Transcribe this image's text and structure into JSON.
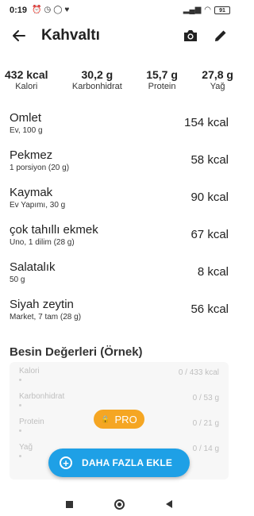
{
  "status_bar": {
    "time": "0:19",
    "battery": "91",
    "icons": [
      "alarm-icon",
      "clock-icon",
      "whatsapp-icon",
      "app-notification-icon",
      "signal-icon",
      "wifi-icon",
      "battery-icon"
    ]
  },
  "app_bar": {
    "title": "Kahvaltı",
    "back_icon": "arrow-left-icon",
    "actions": [
      "camera-icon",
      "edit-pencil-icon"
    ]
  },
  "summary": [
    {
      "value": "432 kcal",
      "label": "Kalori"
    },
    {
      "value": "30,2 g",
      "label": "Karbonhidrat"
    },
    {
      "value": "15,7 g",
      "label": "Protein"
    },
    {
      "value": "27,8 g",
      "label": "Yağ"
    }
  ],
  "foods": [
    {
      "name": "Omlet",
      "desc": "Ev, 100 g",
      "kcal": "154 kcal"
    },
    {
      "name": "Pekmez",
      "desc": "1 porsiyon (20 g)",
      "kcal": "58 kcal"
    },
    {
      "name": "Kaymak",
      "desc": "Ev Yapımı, 30 g",
      "kcal": "90 kcal"
    },
    {
      "name": "çok tahıllı ekmek",
      "desc": "Uno, 1 dilim (28 g)",
      "kcal": "67 kcal"
    },
    {
      "name": "Salatalık",
      "desc": "50 g",
      "kcal": "8 kcal"
    },
    {
      "name": "Siyah zeytin",
      "desc": "Market, 7 tam (28 g)",
      "kcal": "56 kcal"
    }
  ],
  "nutrition": {
    "title": "Besin Değerleri (Örnek)",
    "rows": [
      {
        "label": "Kalori",
        "value": "0 / 433 kcal"
      },
      {
        "label": "Karbonhidrat",
        "value": "0 / 53 g"
      },
      {
        "label": "Protein",
        "value": "0 / 21 g"
      },
      {
        "label": "Yağ",
        "value": "0 / 14 g"
      }
    ],
    "pro_badge": "PRO"
  },
  "fab": {
    "label": "DAHA FAZLA EKLE"
  },
  "colors": {
    "accent": "#1ea0e6",
    "pro": "#f5a623"
  }
}
